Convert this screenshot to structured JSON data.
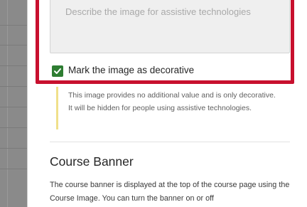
{
  "alt_text": {
    "placeholder": "Describe the image for assistive technologies"
  },
  "decorative": {
    "checked": true,
    "label": "Mark the image as decorative",
    "help_text": "This image provides no additional value and is only decorative. It will be hidden for people using assistive technologies."
  },
  "course_banner": {
    "title": "Course Banner",
    "description": "The course banner is displayed at the top of the course page using the Course Image. You can turn the banner on or off"
  },
  "colors": {
    "highlight_border": "#c8102e",
    "checkbox_fill": "#2e7d32",
    "help_accent": "#f0e08a"
  }
}
